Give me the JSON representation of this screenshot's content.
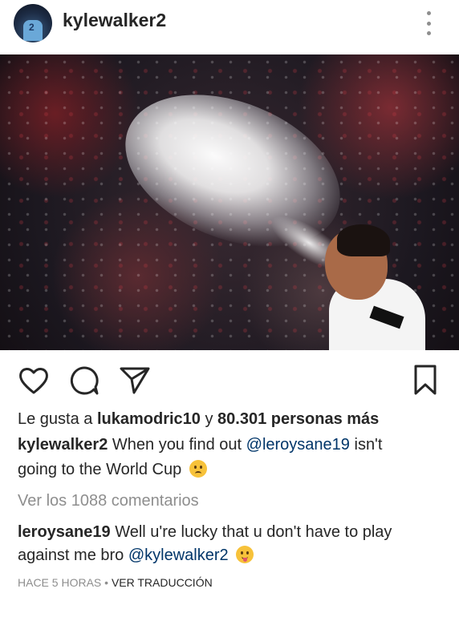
{
  "post": {
    "username": "kylewalker2",
    "avatar_label": "2",
    "menu_icon": "more-vertical-icon"
  },
  "actions": {
    "like_icon": "heart-icon",
    "comment_icon": "comment-icon",
    "share_icon": "send-icon",
    "save_icon": "bookmark-icon"
  },
  "likes": {
    "prefix": "Le gusta a ",
    "user": "lukamodric10",
    "connector": " y ",
    "count_text": "80.301 personas más"
  },
  "caption": {
    "username": "kylewalker2",
    "text_before": " When you find out ",
    "mention": "@leroysane19",
    "text_after": " isn't",
    "line2": "going to the World Cup"
  },
  "view_comments": "Ver los 1088 comentarios",
  "comment": {
    "username": "leroysane19",
    "line1": " Well u're lucky that u don't have to play",
    "line2_prefix": "against me bro ",
    "mention": "@kylewalker2"
  },
  "meta": {
    "time": "HACE 5 HORAS",
    "separator": " • ",
    "translate": "VER TRADUCCIÓN"
  },
  "colors": {
    "text": "#262626",
    "muted": "#8e8e8e",
    "link": "#003569"
  }
}
